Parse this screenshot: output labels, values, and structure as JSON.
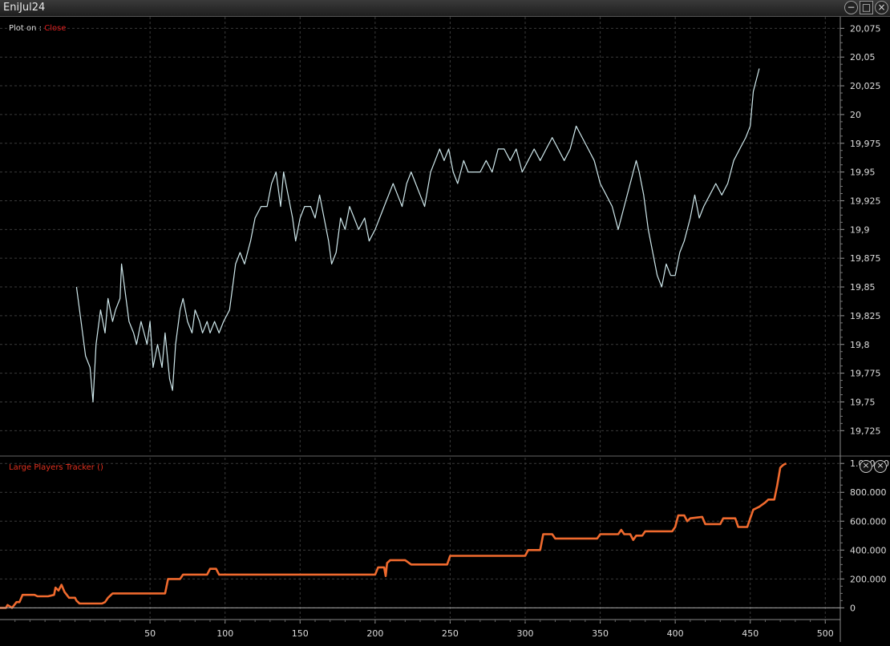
{
  "window": {
    "title": "EniJul24",
    "minimize_icon": "minimize-icon",
    "maximize_icon": "maximize-icon",
    "close_icon": "close-icon"
  },
  "price_panel": {
    "plot_on_label": "Plot on :",
    "plot_on_value": "Close"
  },
  "indicator_panel": {
    "label": "Large Players Tracker ()"
  },
  "colors": {
    "background": "#000000",
    "price_line": "#cfe8ec",
    "indicator_line": "#f06a2e",
    "grid": "#3a3a3a",
    "axis_text": "#dddddd"
  },
  "chart_data": [
    {
      "type": "line",
      "title": "",
      "series": [
        {
          "name": "",
          "values": [
            [
              1,
              19.85
            ],
            [
              4,
              19.82
            ],
            [
              7,
              19.79
            ],
            [
              10,
              19.78
            ],
            [
              12,
              19.75
            ],
            [
              14,
              19.8
            ],
            [
              17,
              19.83
            ],
            [
              20,
              19.81
            ],
            [
              22,
              19.84
            ],
            [
              25,
              19.82
            ],
            [
              27,
              19.83
            ],
            [
              30,
              19.84
            ],
            [
              31,
              19.87
            ],
            [
              33,
              19.85
            ],
            [
              36,
              19.82
            ],
            [
              39,
              19.81
            ],
            [
              41,
              19.8
            ],
            [
              44,
              19.82
            ],
            [
              46,
              19.81
            ],
            [
              48,
              19.8
            ],
            [
              50,
              19.82
            ],
            [
              52,
              19.78
            ],
            [
              55,
              19.8
            ],
            [
              58,
              19.78
            ],
            [
              60,
              19.81
            ],
            [
              63,
              19.77
            ],
            [
              65,
              19.76
            ],
            [
              67,
              19.8
            ],
            [
              70,
              19.83
            ],
            [
              72,
              19.84
            ],
            [
              75,
              19.82
            ],
            [
              78,
              19.81
            ],
            [
              80,
              19.83
            ],
            [
              83,
              19.82
            ],
            [
              85,
              19.81
            ],
            [
              88,
              19.82
            ],
            [
              90,
              19.81
            ],
            [
              93,
              19.82
            ],
            [
              96,
              19.81
            ],
            [
              99,
              19.82
            ],
            [
              103,
              19.83
            ],
            [
              105,
              19.85
            ],
            [
              107,
              19.87
            ],
            [
              110,
              19.88
            ],
            [
              113,
              19.87
            ],
            [
              117,
              19.89
            ],
            [
              120,
              19.91
            ],
            [
              124,
              19.92
            ],
            [
              128,
              19.92
            ],
            [
              131,
              19.94
            ],
            [
              134,
              19.95
            ],
            [
              137,
              19.92
            ],
            [
              139,
              19.95
            ],
            [
              142,
              19.93
            ],
            [
              145,
              19.91
            ],
            [
              147,
              19.89
            ],
            [
              150,
              19.91
            ],
            [
              153,
              19.92
            ],
            [
              157,
              19.92
            ],
            [
              160,
              19.91
            ],
            [
              163,
              19.93
            ],
            [
              166,
              19.91
            ],
            [
              169,
              19.89
            ],
            [
              171,
              19.87
            ],
            [
              174,
              19.88
            ],
            [
              177,
              19.91
            ],
            [
              180,
              19.9
            ],
            [
              183,
              19.92
            ],
            [
              186,
              19.91
            ],
            [
              189,
              19.9
            ],
            [
              193,
              19.91
            ],
            [
              196,
              19.89
            ],
            [
              200,
              19.9
            ],
            [
              203,
              19.91
            ],
            [
              206,
              19.92
            ],
            [
              209,
              19.93
            ],
            [
              212,
              19.94
            ],
            [
              215,
              19.93
            ],
            [
              218,
              19.92
            ],
            [
              221,
              19.94
            ],
            [
              224,
              19.95
            ],
            [
              227,
              19.94
            ],
            [
              230,
              19.93
            ],
            [
              233,
              19.92
            ],
            [
              237,
              19.95
            ],
            [
              240,
              19.96
            ],
            [
              243,
              19.97
            ],
            [
              246,
              19.96
            ],
            [
              249,
              19.97
            ],
            [
              252,
              19.95
            ],
            [
              255,
              19.94
            ],
            [
              259,
              19.96
            ],
            [
              262,
              19.95
            ],
            [
              266,
              19.95
            ],
            [
              270,
              19.95
            ],
            [
              274,
              19.96
            ],
            [
              278,
              19.95
            ],
            [
              282,
              19.97
            ],
            [
              286,
              19.97
            ],
            [
              290,
              19.96
            ],
            [
              294,
              19.97
            ],
            [
              298,
              19.95
            ],
            [
              302,
              19.96
            ],
            [
              306,
              19.97
            ],
            [
              310,
              19.96
            ],
            [
              314,
              19.97
            ],
            [
              318,
              19.98
            ],
            [
              322,
              19.97
            ],
            [
              326,
              19.96
            ],
            [
              330,
              19.97
            ],
            [
              334,
              19.99
            ],
            [
              338,
              19.98
            ],
            [
              342,
              19.97
            ],
            [
              346,
              19.96
            ],
            [
              350,
              19.94
            ],
            [
              354,
              19.93
            ],
            [
              358,
              19.92
            ],
            [
              362,
              19.9
            ],
            [
              366,
              19.92
            ],
            [
              370,
              19.94
            ],
            [
              374,
              19.96
            ],
            [
              376,
              19.95
            ],
            [
              379,
              19.93
            ],
            [
              382,
              19.9
            ],
            [
              385,
              19.88
            ],
            [
              388,
              19.86
            ],
            [
              391,
              19.85
            ],
            [
              394,
              19.87
            ],
            [
              397,
              19.86
            ],
            [
              400,
              19.86
            ],
            [
              403,
              19.88
            ],
            [
              406,
              19.89
            ],
            [
              410,
              19.91
            ],
            [
              413,
              19.93
            ],
            [
              416,
              19.91
            ],
            [
              419,
              19.92
            ],
            [
              423,
              19.93
            ],
            [
              427,
              19.94
            ],
            [
              431,
              19.93
            ],
            [
              435,
              19.94
            ],
            [
              439,
              19.96
            ],
            [
              443,
              19.97
            ],
            [
              447,
              19.98
            ],
            [
              450,
              19.99
            ],
            [
              452,
              20.02
            ],
            [
              454,
              20.03
            ],
            [
              456,
              20.04
            ]
          ]
        }
      ],
      "xlim": [
        -50,
        510
      ],
      "ylim": [
        19.705,
        20.085
      ],
      "y_ticks": [
        "20,075",
        "20,05",
        "20,025",
        "20",
        "19,975",
        "19,95",
        "19,925",
        "19,9",
        "19,875",
        "19,85",
        "19,825",
        "19,8",
        "19,775",
        "19,75",
        "19,725"
      ],
      "y_tick_values": [
        20.075,
        20.05,
        20.025,
        20,
        19.975,
        19.95,
        19.925,
        19.9,
        19.875,
        19.85,
        19.825,
        19.8,
        19.775,
        19.75,
        19.725
      ],
      "grid": true
    },
    {
      "type": "line",
      "title": "Large Players Tracker ()",
      "series": [
        {
          "name": "",
          "values": [
            [
              -50,
              0
            ],
            [
              -46,
              0
            ],
            [
              -45,
              20
            ],
            [
              -42,
              0
            ],
            [
              -39,
              40
            ],
            [
              -37,
              40
            ],
            [
              -35,
              90
            ],
            [
              -27,
              90
            ],
            [
              -25,
              80
            ],
            [
              -20,
              80
            ],
            [
              -18,
              80
            ],
            [
              -14,
              90
            ],
            [
              -13,
              140
            ],
            [
              -11,
              120
            ],
            [
              -9,
              160
            ],
            [
              -7,
              110
            ],
            [
              -4,
              70
            ],
            [
              0,
              70
            ],
            [
              1,
              50
            ],
            [
              3,
              30
            ],
            [
              12,
              30
            ],
            [
              18,
              30
            ],
            [
              20,
              40
            ],
            [
              22,
              70
            ],
            [
              25,
              100
            ],
            [
              30,
              100
            ],
            [
              40,
              100
            ],
            [
              60,
              100
            ],
            [
              62,
              200
            ],
            [
              70,
              200
            ],
            [
              72,
              230
            ],
            [
              88,
              230
            ],
            [
              90,
              270
            ],
            [
              94,
              270
            ],
            [
              96,
              230
            ],
            [
              120,
              230
            ],
            [
              150,
              230
            ],
            [
              200,
              230
            ],
            [
              202,
              280
            ],
            [
              206,
              280
            ],
            [
              207,
              220
            ],
            [
              208,
              310
            ],
            [
              210,
              330
            ],
            [
              220,
              330
            ],
            [
              224,
              300
            ],
            [
              248,
              300
            ],
            [
              250,
              360
            ],
            [
              276,
              360
            ],
            [
              300,
              360
            ],
            [
              302,
              400
            ],
            [
              310,
              400
            ],
            [
              312,
              510
            ],
            [
              318,
              510
            ],
            [
              320,
              480
            ],
            [
              348,
              480
            ],
            [
              350,
              510
            ],
            [
              362,
              510
            ],
            [
              364,
              540
            ],
            [
              366,
              510
            ],
            [
              370,
              510
            ],
            [
              372,
              470
            ],
            [
              374,
              500
            ],
            [
              378,
              500
            ],
            [
              380,
              530
            ],
            [
              398,
              530
            ],
            [
              400,
              560
            ],
            [
              402,
              640
            ],
            [
              406,
              640
            ],
            [
              408,
              600
            ],
            [
              410,
              620
            ],
            [
              418,
              630
            ],
            [
              420,
              580
            ],
            [
              430,
              580
            ],
            [
              432,
              620
            ],
            [
              440,
              620
            ],
            [
              442,
              560
            ],
            [
              448,
              560
            ],
            [
              450,
              620
            ],
            [
              452,
              680
            ],
            [
              456,
              700
            ],
            [
              460,
              730
            ],
            [
              462,
              750
            ],
            [
              466,
              750
            ],
            [
              468,
              850
            ],
            [
              470,
              970
            ],
            [
              472,
              990
            ],
            [
              474,
              1000
            ]
          ]
        }
      ],
      "xlim": [
        -50,
        510
      ],
      "ylim": [
        -70,
        1040
      ],
      "y_ticks": [
        "1.000.00",
        "800.000",
        "600.000",
        "400.000",
        "200.000",
        "0"
      ],
      "y_tick_values": [
        1000,
        800,
        600,
        400,
        200,
        0
      ],
      "x_ticks": [
        "50",
        "100",
        "150",
        "200",
        "250",
        "300",
        "350",
        "400",
        "450",
        "500"
      ],
      "x_tick_values": [
        50,
        100,
        150,
        200,
        250,
        300,
        350,
        400,
        450,
        500
      ],
      "grid": true
    }
  ]
}
